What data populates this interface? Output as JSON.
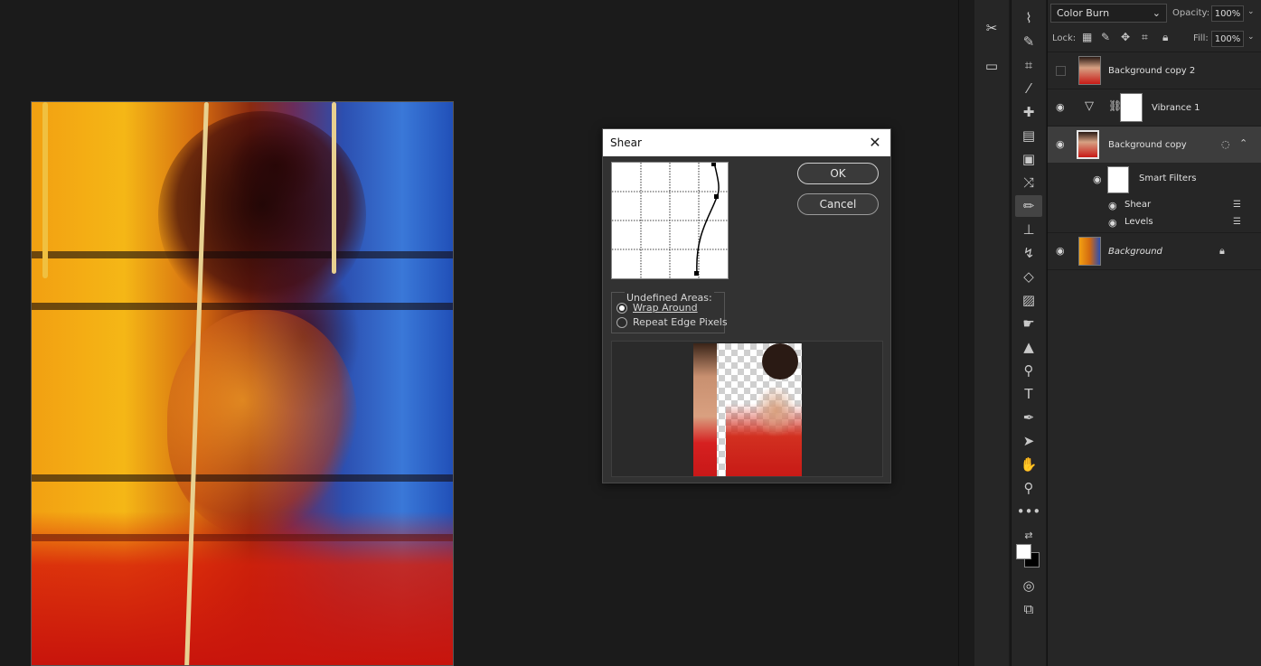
{
  "dialog": {
    "title": "Shear",
    "ok_label": "OK",
    "cancel_label": "Cancel",
    "undefined_areas_label": "Undefined Areas:",
    "options": [
      {
        "label": "Wrap Around",
        "selected": true
      },
      {
        "label": "Repeat Edge Pixels",
        "selected": false
      }
    ]
  },
  "layers_panel": {
    "blend_mode": "Color Burn",
    "opacity_label": "Opacity:",
    "opacity_value": "100%",
    "lock_label": "Lock:",
    "fill_label": "Fill:",
    "fill_value": "100%",
    "layers": [
      {
        "name": "Background copy 2",
        "visible": false
      },
      {
        "name": "Vibrance 1",
        "visible": true
      },
      {
        "name": "Background copy",
        "visible": true,
        "selected": true
      },
      {
        "name": "Smart Filters",
        "visible": true
      },
      {
        "name": "Shear",
        "visible": true
      },
      {
        "name": "Levels",
        "visible": true
      },
      {
        "name": "Background",
        "visible": true,
        "locked": true
      }
    ]
  },
  "colors": {
    "foreground": "#ffffff",
    "background": "#000000",
    "panel": "#262626",
    "workspace": "#1b1b1b"
  }
}
